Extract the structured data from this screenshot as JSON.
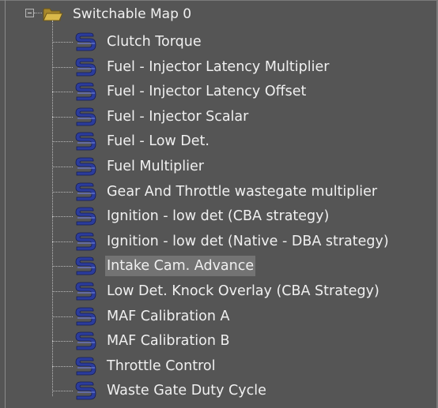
{
  "tree": {
    "root": {
      "label": "Switchable Map 0",
      "expanded": true
    },
    "items": [
      {
        "label": "Clutch Torque"
      },
      {
        "label": "Fuel - Injector Latency Multiplier"
      },
      {
        "label": "Fuel - Injector Latency Offset"
      },
      {
        "label": "Fuel - Injector Scalar"
      },
      {
        "label": "Fuel - Low Det."
      },
      {
        "label": "Fuel Multiplier"
      },
      {
        "label": "Gear And Throttle wastegate multiplier"
      },
      {
        "label": "Ignition - low det (CBA strategy)"
      },
      {
        "label": "Ignition - low det (Native - DBA strategy)"
      },
      {
        "label": "Intake Cam. Advance",
        "selected": true
      },
      {
        "label": "Low Det. Knock Overlay (CBA Strategy)"
      },
      {
        "label": "MAF Calibration A"
      },
      {
        "label": "MAF Calibration B"
      },
      {
        "label": "Throttle Control"
      },
      {
        "label": "Waste Gate Duty Cycle"
      }
    ],
    "item_icon": "s-map-icon",
    "folder_icon": "folder-icon",
    "colors": {
      "background": "#555555",
      "text": "#f0f0f0",
      "selection": "#737373",
      "icon_blue": "#2b3c9c",
      "folder": "#c9a63a"
    }
  }
}
